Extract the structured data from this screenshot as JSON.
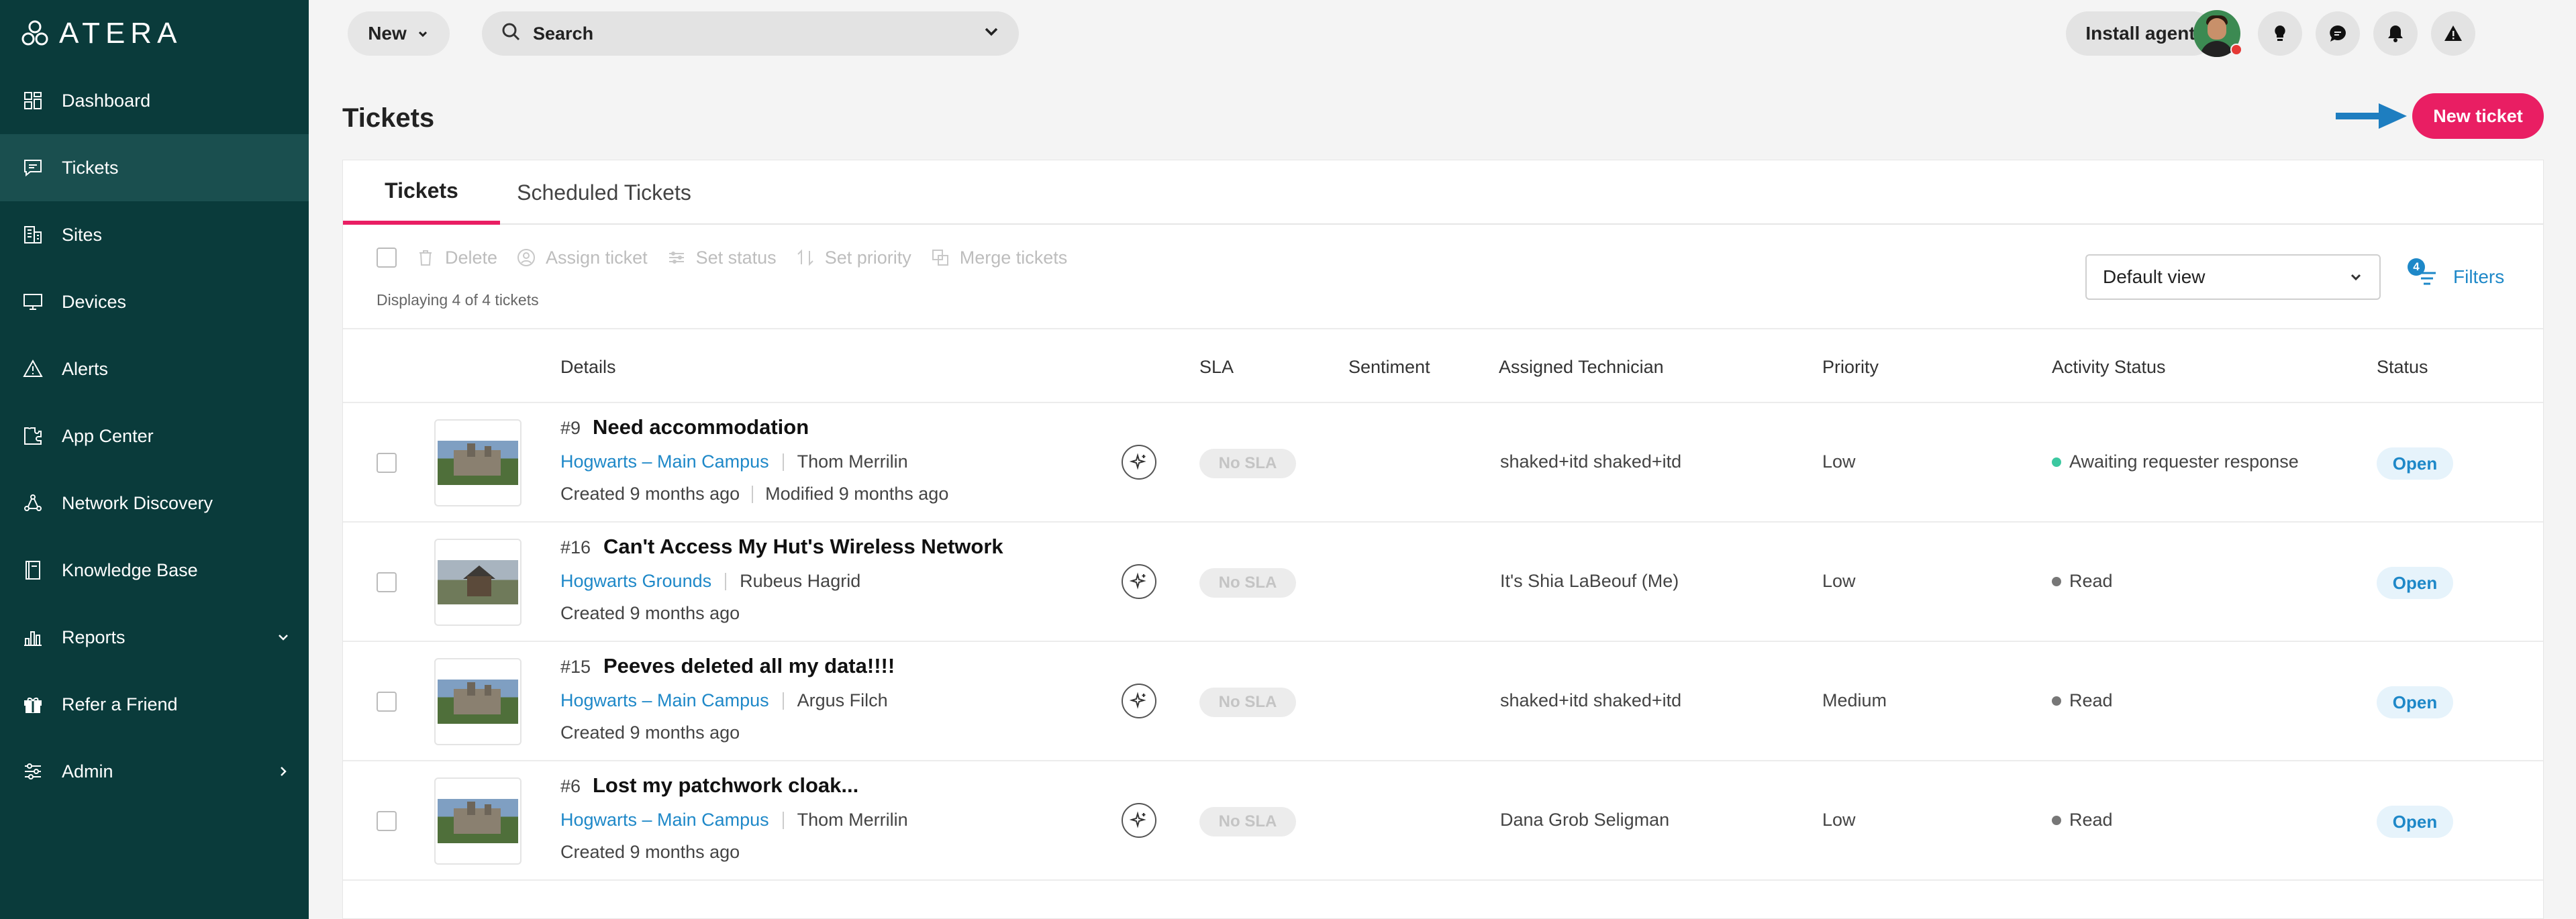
{
  "app": {
    "logo_text": "ATERA",
    "brand_color": "#0a3b3b",
    "accent_color": "#e91e63",
    "link_color": "#1e88c8"
  },
  "sidebar": {
    "items": [
      {
        "label": "Dashboard",
        "icon": "dashboard-icon"
      },
      {
        "label": "Tickets",
        "icon": "tickets-icon",
        "active": true
      },
      {
        "label": "Sites",
        "icon": "sites-icon"
      },
      {
        "label": "Devices",
        "icon": "devices-icon"
      },
      {
        "label": "Alerts",
        "icon": "alerts-icon"
      },
      {
        "label": "App Center",
        "icon": "app-center-icon"
      },
      {
        "label": "Network Discovery",
        "icon": "network-discovery-icon"
      },
      {
        "label": "Knowledge Base",
        "icon": "knowledge-base-icon"
      },
      {
        "label": "Reports",
        "icon": "reports-icon",
        "chevron": "down"
      },
      {
        "label": "Refer a Friend",
        "icon": "gift-icon"
      },
      {
        "label": "Admin",
        "icon": "admin-icon",
        "chevron": "right"
      }
    ]
  },
  "topbar": {
    "new_label": "New",
    "search_label": "Search",
    "install_label": "Install agent",
    "icons": [
      "lightbulb-icon",
      "chat-icon",
      "bell-icon",
      "warning-icon"
    ]
  },
  "page": {
    "title": "Tickets",
    "new_ticket_label": "New ticket"
  },
  "tabs": [
    {
      "label": "Tickets",
      "active": true
    },
    {
      "label": "Scheduled Tickets"
    }
  ],
  "toolbar": {
    "delete": "Delete",
    "assign": "Assign ticket",
    "set_status": "Set status",
    "set_priority": "Set priority",
    "merge": "Merge tickets",
    "displaying": "Displaying 4 of 4 tickets",
    "view": "Default view",
    "filters": "Filters",
    "filter_count": "4"
  },
  "columns": {
    "details": "Details",
    "sla": "SLA",
    "sentiment": "Sentiment",
    "technician": "Assigned Technician",
    "priority": "Priority",
    "activity": "Activity Status",
    "status": "Status"
  },
  "tickets": [
    {
      "number": "#9",
      "title": "Need accommodation",
      "site": "Hogwarts – Main Campus",
      "requester": "Thom Merrilin",
      "created": "Created 9 months ago",
      "modified": "Modified 9 months ago",
      "sla": "No SLA",
      "technician": "shaked+itd shaked+itd",
      "priority": "Low",
      "activity": "Awaiting requester response",
      "status": "Open"
    },
    {
      "number": "#16",
      "title": "Can't Access My Hut's Wireless Network",
      "site": "Hogwarts Grounds",
      "requester": "Rubeus Hagrid",
      "created": "Created 9 months ago",
      "sla": "No SLA",
      "technician": "It's Shia LaBeouf (Me)",
      "priority": "Low",
      "activity": "Read",
      "status": "Open"
    },
    {
      "number": "#15",
      "title": "Peeves deleted all my data!!!!",
      "site": "Hogwarts – Main Campus",
      "requester": "Argus Filch",
      "created": "Created 9 months ago",
      "sla": "No SLA",
      "technician": "shaked+itd shaked+itd",
      "priority": "Medium",
      "activity": "Read",
      "status": "Open"
    },
    {
      "number": "#6",
      "title": "Lost my patchwork cloak...",
      "site": "Hogwarts – Main Campus",
      "requester": "Thom Merrilin",
      "created": "Created 9 months ago",
      "sla": "No SLA",
      "technician": "Dana Grob Seligman",
      "priority": "Low",
      "activity": "Read",
      "status": "Open"
    }
  ]
}
